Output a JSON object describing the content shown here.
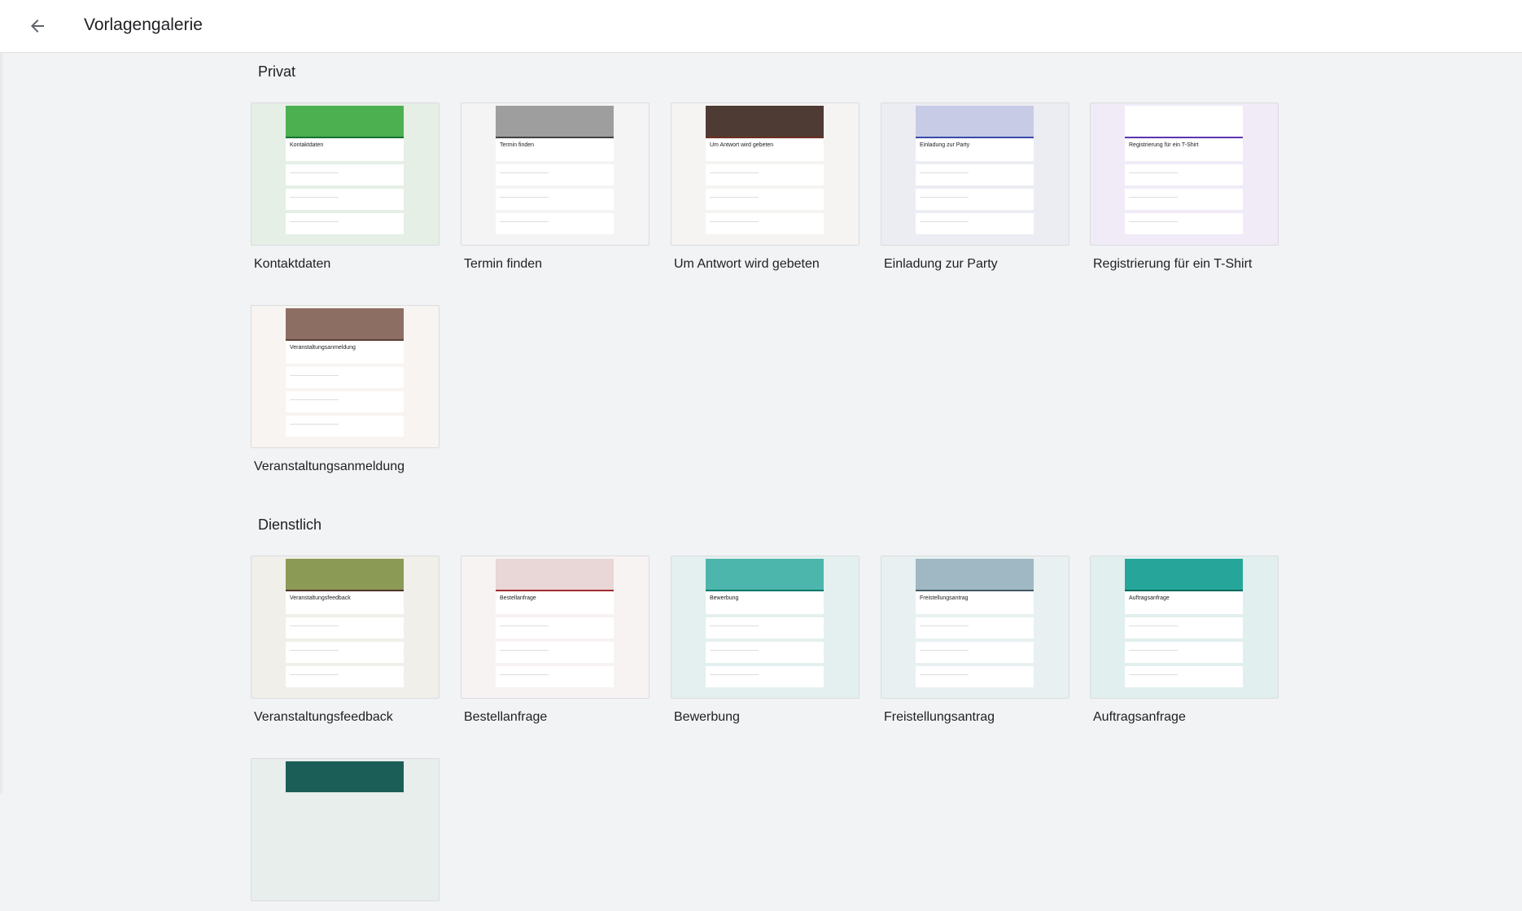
{
  "header": {
    "title": "Vorlagengalerie",
    "back_icon": "arrow-back-icon"
  },
  "sections": {
    "private": {
      "title": "Privat",
      "templates": [
        {
          "label": "Kontaktdaten",
          "form_title": "Kontaktdaten",
          "bg": "#e6efe5",
          "accent": "#137333",
          "banner": "#4caf50"
        },
        {
          "label": "Termin finden",
          "form_title": "Termin finden",
          "bg": "#f4f4f4",
          "accent": "#424242",
          "banner": "#9e9e9e"
        },
        {
          "label": "Um Antwort wird gebeten",
          "form_title": "Um Antwort wird gebeten",
          "bg": "#f5f4f2",
          "accent": "#6d2f22",
          "banner": "#4e3b33"
        },
        {
          "label": "Einladung zur Party",
          "form_title": "Einladung zur Party",
          "bg": "#ececf3",
          "accent": "#3949ab",
          "banner": "#c7cbe6"
        },
        {
          "label": "Registrierung für ein T-Shirt",
          "form_title": "Registrierung für ein T-Shirt",
          "bg": "#f0ebf7",
          "accent": "#5e35b1",
          "banner": "#ffffff"
        },
        {
          "label": "Veranstaltungsanmeldung",
          "form_title": "Veranstaltungsanmeldung",
          "bg": "#f7f4f1",
          "accent": "#5d4037",
          "banner": "#8d6e63"
        }
      ]
    },
    "business": {
      "title": "Dienstlich",
      "templates": [
        {
          "label": "Veranstaltungsfeedback",
          "form_title": "Veranstaltungsfeedback",
          "bg": "#f1efe9",
          "accent": "#4e342e",
          "banner": "#8b9a55"
        },
        {
          "label": "Bestellanfrage",
          "form_title": "Bestellanfrage",
          "bg": "#f7f3f2",
          "accent": "#a32d2d",
          "banner": "#e9d6d6"
        },
        {
          "label": "Bewerbung",
          "form_title": "Bewerbung",
          "bg": "#e4f0ef",
          "accent": "#00796b",
          "banner": "#4db6ac"
        },
        {
          "label": "Freistellungsantrag",
          "form_title": "Freistellungsantrag",
          "bg": "#e8f0f1",
          "accent": "#455a64",
          "banner": "#9fb8c3"
        },
        {
          "label": "Auftragsanfrage",
          "form_title": "Auftragsanfrage",
          "bg": "#e1efee",
          "accent": "#00695c",
          "banner": "#26a69a"
        },
        {
          "label": "",
          "form_title": "",
          "bg": "#e7eeec",
          "accent": "#00796b",
          "banner": "#1b5e57"
        }
      ]
    }
  }
}
